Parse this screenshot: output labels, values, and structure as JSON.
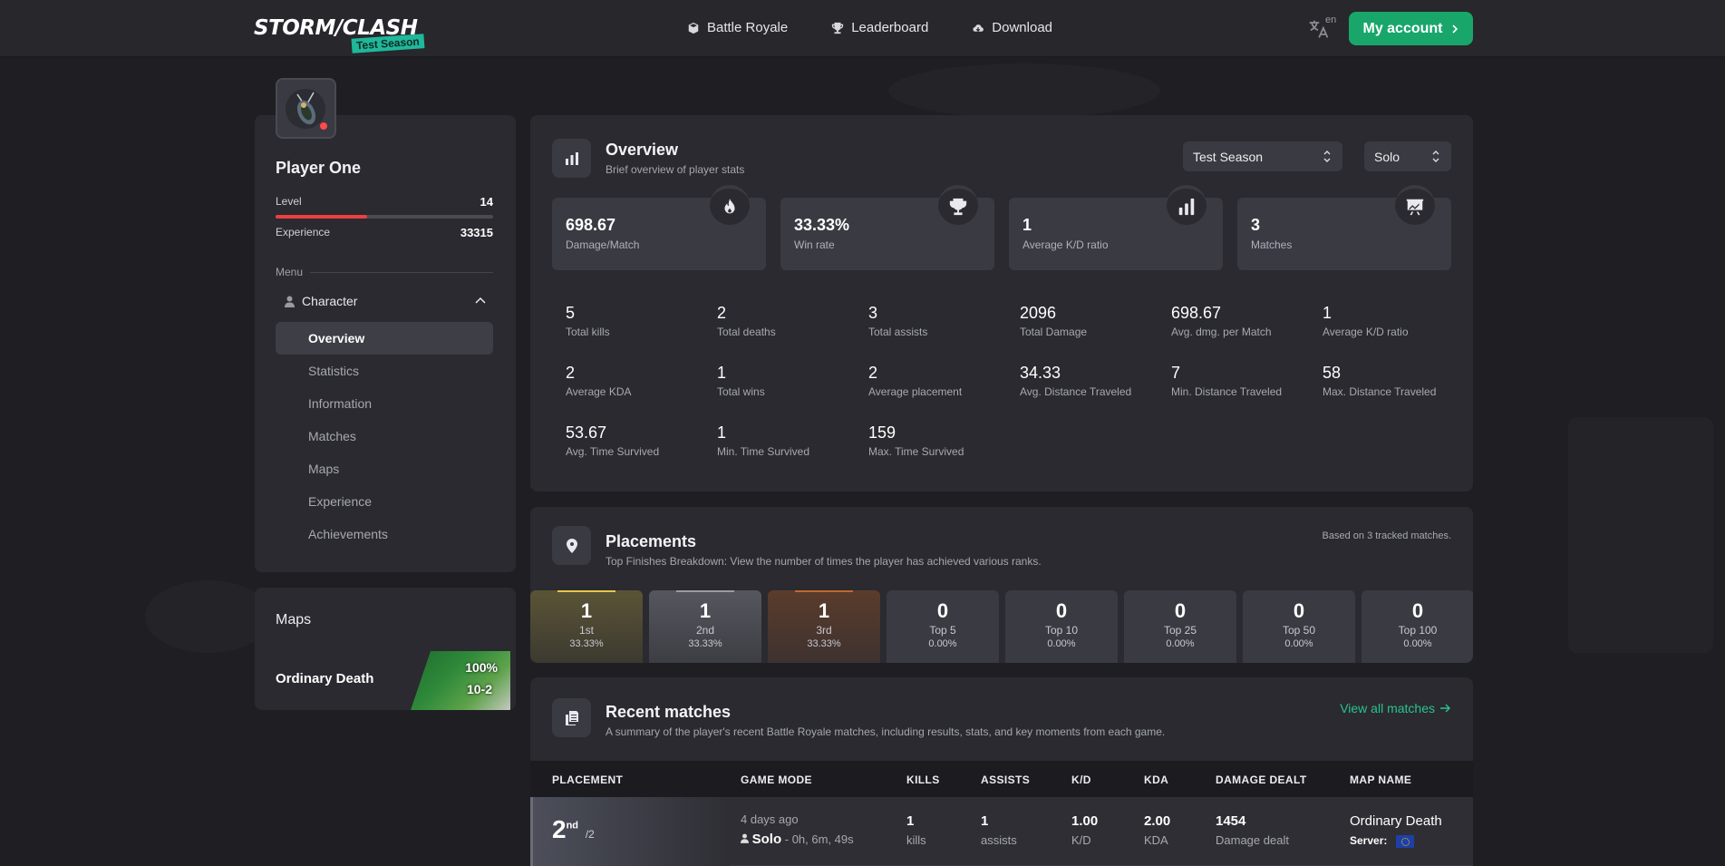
{
  "header": {
    "logo": "STORM/CLASH",
    "logo_badge": "Test Season",
    "nav": [
      {
        "label": "Battle Royale",
        "icon": "cube-icon"
      },
      {
        "label": "Leaderboard",
        "icon": "trophy-icon"
      },
      {
        "label": "Download",
        "icon": "cloud-download-icon"
      }
    ],
    "language": "en",
    "account_label": "My account",
    "accent_color": "#18a66b"
  },
  "profile": {
    "name": "Player One",
    "level_label": "Level",
    "level": "14",
    "level_progress": 0.42,
    "experience_label": "Experience",
    "experience": "33315",
    "menu_label": "Menu",
    "menu_parent": "Character",
    "menu_items": [
      "Overview",
      "Statistics",
      "Information",
      "Matches",
      "Maps",
      "Experience",
      "Achievements"
    ],
    "active_item": "Overview"
  },
  "maps_card": {
    "title": "Maps",
    "map_name": "Ordinary Death",
    "win_pct": "100%",
    "score": "10-2"
  },
  "overview": {
    "title": "Overview",
    "subtitle": "Brief overview of player stats",
    "season_select": "Test Season",
    "mode_select": "Solo",
    "kpis": [
      {
        "value": "698.67",
        "label": "Damage/Match",
        "icon": "flame-icon"
      },
      {
        "value": "33.33%",
        "label": "Win rate",
        "icon": "trophy-icon"
      },
      {
        "value": "1",
        "label": "Average K/D ratio",
        "icon": "bar-chart-icon"
      },
      {
        "value": "3",
        "label": "Matches",
        "icon": "presentation-chart-icon"
      }
    ],
    "stats": [
      {
        "value": "5",
        "label": "Total kills"
      },
      {
        "value": "2",
        "label": "Total deaths"
      },
      {
        "value": "3",
        "label": "Total assists"
      },
      {
        "value": "2096",
        "label": "Total Damage"
      },
      {
        "value": "698.67",
        "label": "Avg. dmg. per Match"
      },
      {
        "value": "1",
        "label": "Average K/D ratio"
      },
      {
        "value": "2",
        "label": "Average KDA"
      },
      {
        "value": "1",
        "label": "Total wins"
      },
      {
        "value": "2",
        "label": "Average placement"
      },
      {
        "value": "34.33",
        "label": "Avg. Distance Traveled"
      },
      {
        "value": "7",
        "label": "Min. Distance Traveled"
      },
      {
        "value": "58",
        "label": "Max. Distance Traveled"
      },
      {
        "value": "53.67",
        "label": "Avg. Time Survived"
      },
      {
        "value": "1",
        "label": "Min. Time Survived"
      },
      {
        "value": "159",
        "label": "Max. Time Survived"
      }
    ]
  },
  "placements": {
    "title": "Placements",
    "subtitle": "Top Finishes Breakdown: View the number of times the player has achieved various ranks.",
    "note": "Based on 3 tracked matches.",
    "tiles": [
      {
        "value": "1",
        "label": "1st",
        "pct": "33.33%",
        "style": "gold",
        "line": "#e8c64a"
      },
      {
        "value": "1",
        "label": "2nd",
        "pct": "33.33%",
        "style": "silver",
        "line": "#9a9ca4"
      },
      {
        "value": "1",
        "label": "3rd",
        "pct": "33.33%",
        "style": "bronze",
        "line": "#c0682e"
      },
      {
        "value": "0",
        "label": "Top 5",
        "pct": "0.00%",
        "style": "",
        "line": ""
      },
      {
        "value": "0",
        "label": "Top 10",
        "pct": "0.00%",
        "style": "",
        "line": ""
      },
      {
        "value": "0",
        "label": "Top 25",
        "pct": "0.00%",
        "style": "",
        "line": ""
      },
      {
        "value": "0",
        "label": "Top 50",
        "pct": "0.00%",
        "style": "",
        "line": ""
      },
      {
        "value": "0",
        "label": "Top 100",
        "pct": "0.00%",
        "style": "",
        "line": ""
      }
    ]
  },
  "recent": {
    "title": "Recent matches",
    "subtitle": "A summary of the player's recent Battle Royale matches, including results, stats, and key moments from each game.",
    "view_all": "View all matches",
    "columns": [
      "PLACEMENT",
      "GAME MODE",
      "KILLS",
      "ASSISTS",
      "K/D",
      "KDA",
      "DAMAGE DEALT",
      "MAP NAME"
    ],
    "rows": [
      {
        "placement": "2",
        "placement_suffix": "nd",
        "of": "/2",
        "time_ago": "4 days ago",
        "mode": "Solo",
        "duration": "- 0h, 6m, 49s",
        "kills": "1",
        "kills_label": "kills",
        "assists": "1",
        "assists_label": "assists",
        "kd": "1.00",
        "kd_label": "K/D",
        "kda": "2.00",
        "kda_label": "KDA",
        "damage": "1454",
        "damage_label": "Damage dealt",
        "map": "Ordinary Death",
        "server_label": "Server:"
      }
    ]
  }
}
